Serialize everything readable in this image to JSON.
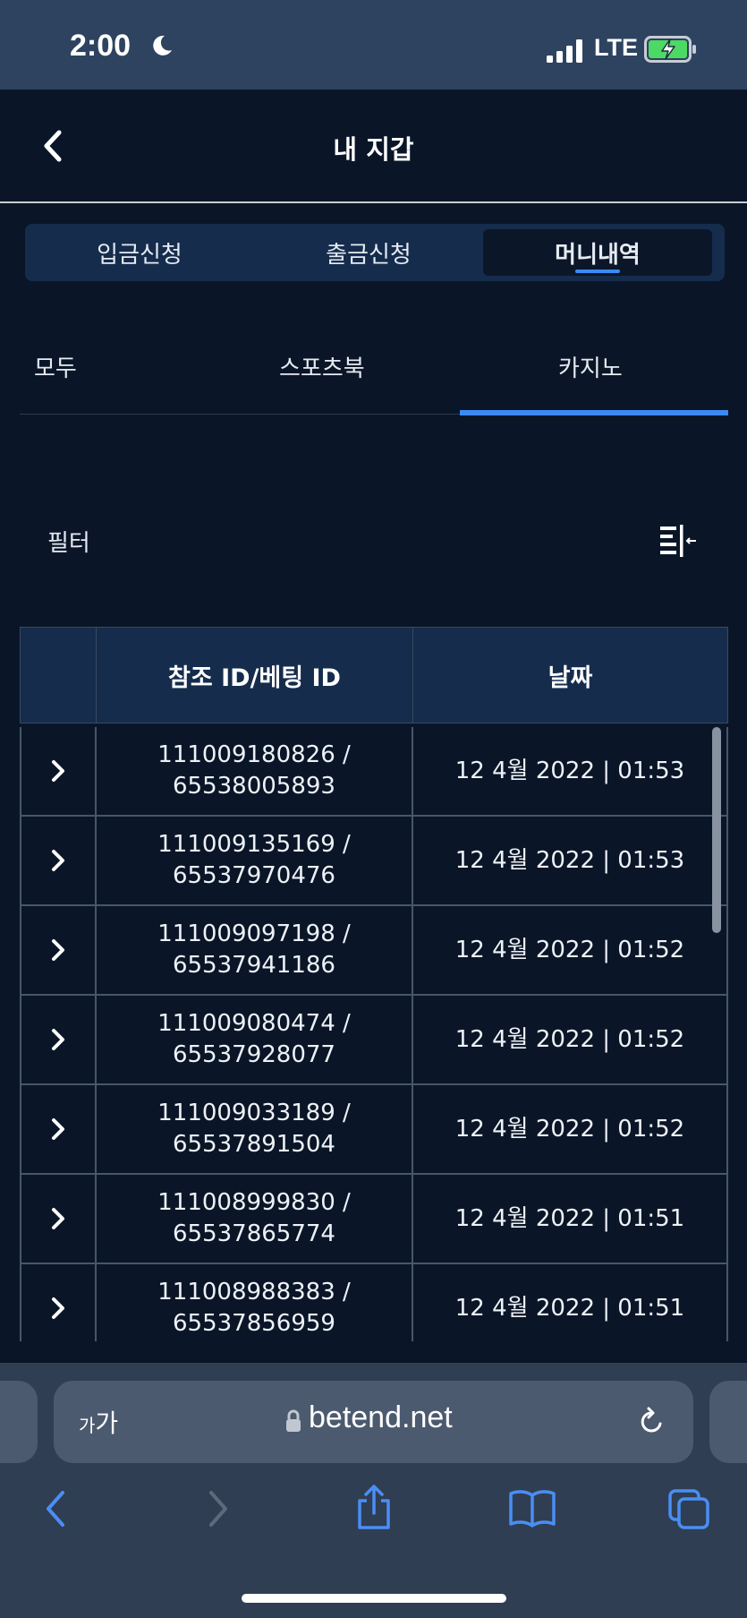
{
  "status_bar": {
    "time": "2:00",
    "network": "LTE"
  },
  "header": {
    "title": "내 지갑"
  },
  "main_tabs": [
    {
      "label": "입금신청",
      "active": false
    },
    {
      "label": "출금신청",
      "active": false
    },
    {
      "label": "머니내역",
      "active": true
    }
  ],
  "sub_tabs": [
    {
      "label": "모두",
      "active": false
    },
    {
      "label": "스포츠북",
      "active": false
    },
    {
      "label": "카지노",
      "active": true
    }
  ],
  "filter": {
    "label": "필터"
  },
  "table": {
    "headers": [
      "",
      "참조 ID/베팅 ID",
      "날짜"
    ],
    "rows": [
      {
        "ref_id": "111009180826 /",
        "bet_id": "65538005893",
        "date": "12 4월 2022 | 01:53"
      },
      {
        "ref_id": "111009135169 /",
        "bet_id": "65537970476",
        "date": "12 4월 2022 | 01:53"
      },
      {
        "ref_id": "111009097198 /",
        "bet_id": "65537941186",
        "date": "12 4월 2022 | 01:52"
      },
      {
        "ref_id": "111009080474 /",
        "bet_id": "65537928077",
        "date": "12 4월 2022 | 01:52"
      },
      {
        "ref_id": "111009033189 /",
        "bet_id": "65537891504",
        "date": "12 4월 2022 | 01:52"
      },
      {
        "ref_id": "111008999830 /",
        "bet_id": "65537865774",
        "date": "12 4월 2022 | 01:51"
      },
      {
        "ref_id": "111008988383 /",
        "bet_id": "65537856959",
        "date": "12 4월 2022 | 01:51"
      }
    ]
  },
  "browser": {
    "aa_small": "가",
    "aa_large": "가",
    "url": "betend.net"
  },
  "colors": {
    "accent": "#3d8af7",
    "background": "#0a1628",
    "tab_bar": "#152c4c",
    "status_bar": "#2d4360",
    "browser_bar": "#2f3e52",
    "browser_icon": "#4a8ef5",
    "battery_charging": "#4cd964"
  }
}
